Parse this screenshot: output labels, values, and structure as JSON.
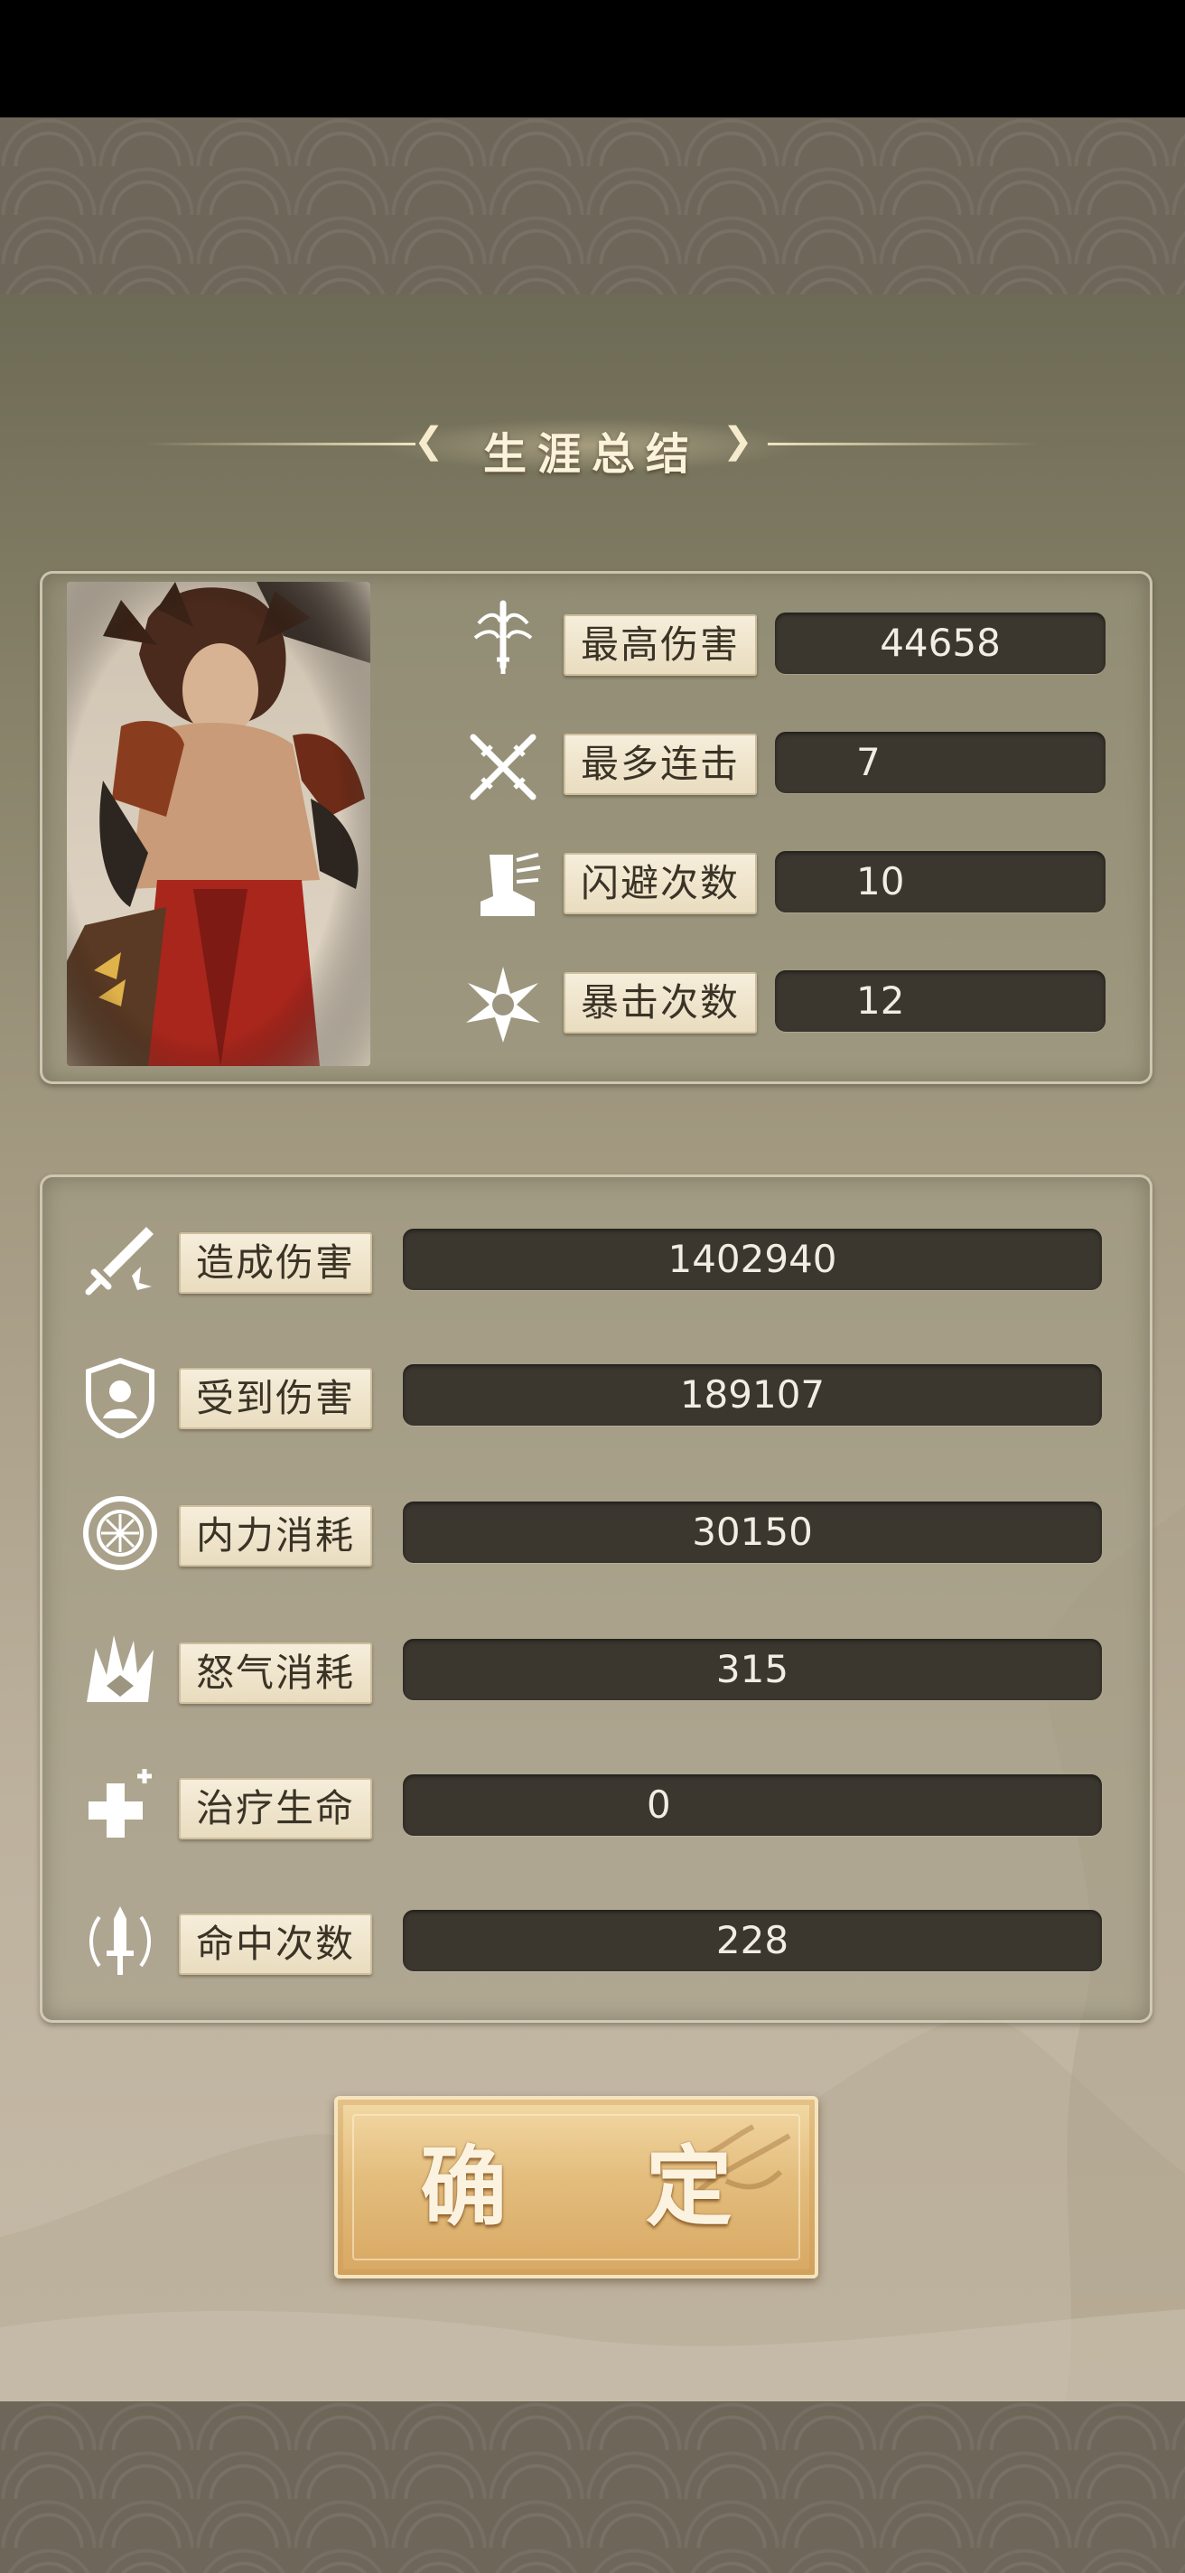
{
  "title": "生涯总结",
  "hero": {
    "portrait_icon": "warrior-portrait"
  },
  "top_stats": [
    {
      "icon": "bamboo-sword-icon",
      "label": "最高伤害",
      "value": "44658"
    },
    {
      "icon": "crossed-swords-icon",
      "label": "最多连击",
      "value": "7"
    },
    {
      "icon": "boot-icon",
      "label": "闪避次数",
      "value": "10"
    },
    {
      "icon": "burst-icon",
      "label": "暴击次数",
      "value": "12"
    }
  ],
  "bottom_stats": [
    {
      "icon": "sword-icon",
      "label": "造成伤害",
      "value": "1402940"
    },
    {
      "icon": "shield-icon",
      "label": "受到伤害",
      "value": "189107"
    },
    {
      "icon": "circle-emblem-icon",
      "label": "内力消耗",
      "value": "30150"
    },
    {
      "icon": "rage-burst-icon",
      "label": "怒气消耗",
      "value": "315"
    },
    {
      "icon": "heal-cross-icon",
      "label": "治疗生命",
      "value": "0"
    },
    {
      "icon": "hit-dagger-icon",
      "label": "命中次数",
      "value": "228"
    }
  ],
  "confirm_label": "确 定",
  "colors": {
    "value_bg": "#3b372f",
    "label_bg": "#f0e6cf",
    "button_gold": "#e3bd7d"
  }
}
